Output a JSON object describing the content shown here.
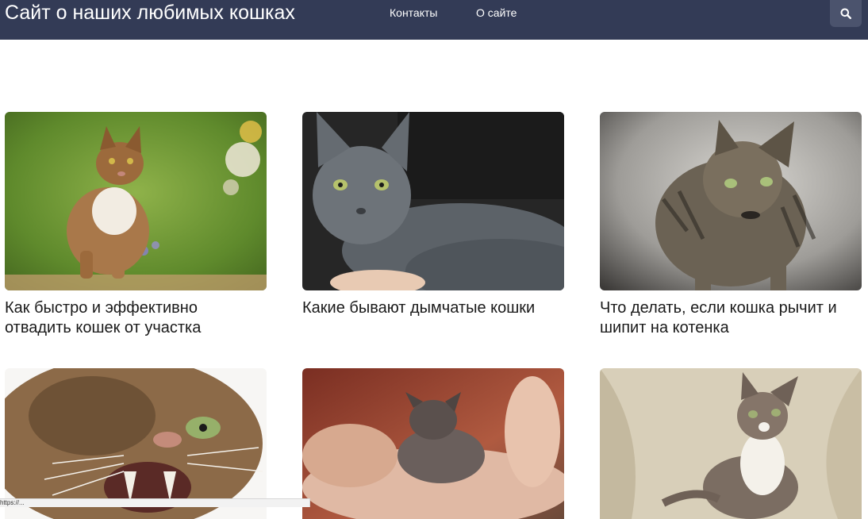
{
  "header": {
    "site_title": "Сайт о наших любимых кошках",
    "nav": [
      {
        "label": "Контакты"
      },
      {
        "label": "О сайте"
      }
    ],
    "search_icon": "search-icon",
    "background_color": "#333b56"
  },
  "cards": [
    {
      "title": "Как быстро и эффективно отвадить кошек от участка"
    },
    {
      "title": "Какие бывают дымчатые кошки"
    },
    {
      "title": "Что делать, если кошка рычит и шипит на котенка"
    },
    {
      "title": ""
    },
    {
      "title": ""
    },
    {
      "title": ""
    }
  ],
  "status_bar": {
    "url": "https://..."
  }
}
